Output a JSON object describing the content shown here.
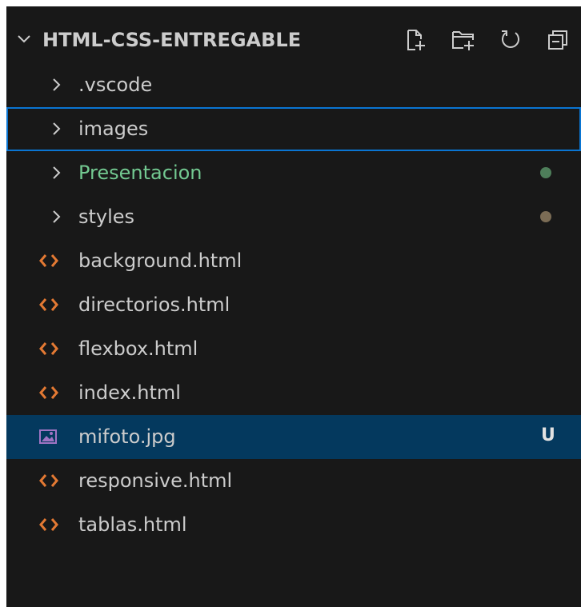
{
  "explorer": {
    "title": "HTML-CSS-ENTREGABLE",
    "actions": [
      {
        "name": "new-file-icon",
        "label": "New File"
      },
      {
        "name": "new-folder-icon",
        "label": "New Folder"
      },
      {
        "name": "refresh-icon",
        "label": "Refresh Explorer"
      },
      {
        "name": "collapse-all-icon",
        "label": "Collapse Folders in Explorer"
      }
    ],
    "items": [
      {
        "label": ".vscode",
        "type": "folder",
        "state": "collapsed"
      },
      {
        "label": "images",
        "type": "folder",
        "state": "collapsed",
        "focused": true
      },
      {
        "label": "Presentacion",
        "type": "folder",
        "state": "collapsed",
        "git_status": "untracked-contents",
        "dot_color": "#4e7e5a"
      },
      {
        "label": "styles",
        "type": "folder",
        "state": "collapsed",
        "git_status": "modified-contents",
        "dot_color": "#7b6c55"
      },
      {
        "label": "background.html",
        "type": "html",
        "icon": "html-icon"
      },
      {
        "label": "directorios.html",
        "type": "html",
        "icon": "html-icon"
      },
      {
        "label": "flexbox.html",
        "type": "html",
        "icon": "html-icon"
      },
      {
        "label": "index.html",
        "type": "html",
        "icon": "html-icon"
      },
      {
        "label": "mifoto.jpg",
        "type": "image",
        "icon": "image-file-icon",
        "selected": true,
        "badge": "U"
      },
      {
        "label": "responsive.html",
        "type": "html",
        "icon": "html-icon"
      },
      {
        "label": "tablas.html",
        "type": "html",
        "icon": "html-icon"
      }
    ]
  },
  "colors": {
    "background": "#181818",
    "text": "#cccccc",
    "git_added_text": "#73c991",
    "html_icon": "#e37933",
    "image_icon": "#a074c4",
    "selection": "#04395e",
    "focus_border": "#0a75d2"
  }
}
